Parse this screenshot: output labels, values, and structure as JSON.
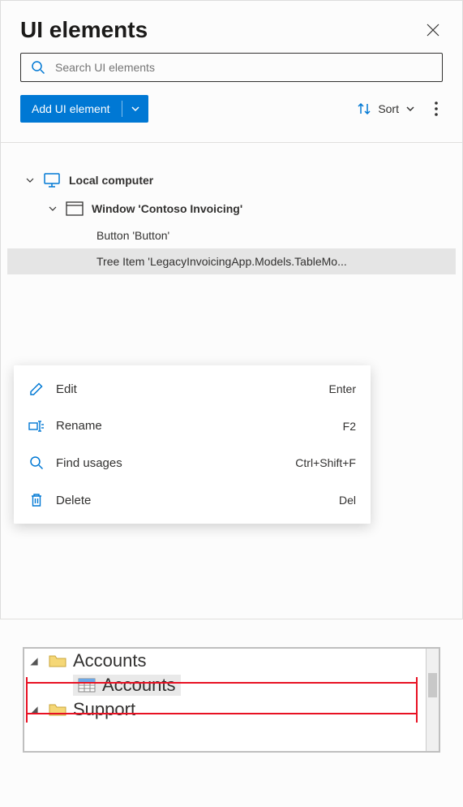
{
  "header": {
    "title": "UI elements"
  },
  "search": {
    "placeholder": "Search UI elements",
    "value": ""
  },
  "toolbar": {
    "add_label": "Add UI element",
    "sort_label": "Sort"
  },
  "tree": {
    "root": "Local computer",
    "window": "Window 'Contoso Invoicing'",
    "items": [
      "Button 'Button'",
      "Tree Item 'LegacyInvoicingApp.Models.TableMo..."
    ]
  },
  "context_menu": [
    {
      "icon": "edit",
      "label": "Edit",
      "shortcut": "Enter"
    },
    {
      "icon": "rename",
      "label": "Rename",
      "shortcut": "F2"
    },
    {
      "icon": "find",
      "label": "Find usages",
      "shortcut": "Ctrl+Shift+F"
    },
    {
      "icon": "delete",
      "label": "Delete",
      "shortcut": "Del"
    }
  ],
  "preview": {
    "rows": [
      {
        "label": "Accounts",
        "type": "folder",
        "expand": true
      },
      {
        "label": "Accounts",
        "type": "table",
        "selected": true
      },
      {
        "label": "Support",
        "type": "folder",
        "expand": true
      }
    ]
  },
  "colors": {
    "primary": "#0078d4",
    "danger": "#e81123"
  }
}
